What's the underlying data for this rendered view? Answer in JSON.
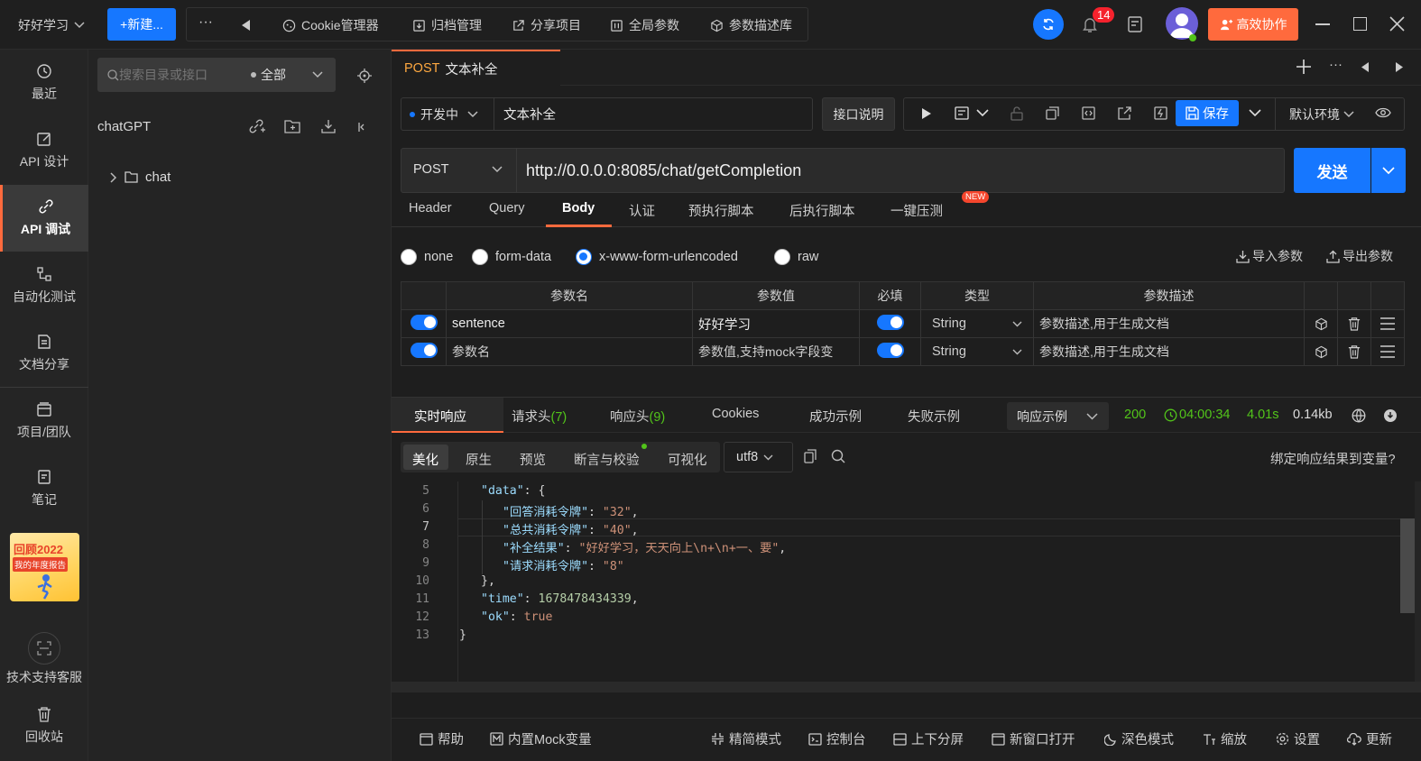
{
  "topbar": {
    "workspace": "好好学习",
    "new_button": "+新建...",
    "more": "···",
    "items": [
      "Cookie管理器",
      "归档管理",
      "分享项目",
      "全局参数",
      "参数描述库"
    ],
    "notification_count": "14",
    "collab_button": "高效协作"
  },
  "nav": {
    "items": [
      "最近",
      "API 设计",
      "API 调试",
      "自动化测试",
      "文档分享",
      "项目/团队",
      "笔记"
    ],
    "promo_line1": "回顾2022",
    "promo_line2": "我的年度报告",
    "support": "技术支持客服",
    "trash": "回收站"
  },
  "tree": {
    "search_placeholder": "搜索目录或接口",
    "filter": "全部",
    "project": "chatGPT",
    "folder": "chat"
  },
  "request_tab": {
    "method": "POST",
    "name": "文本补全"
  },
  "toolbar": {
    "status": "开发中",
    "name": "文本补全",
    "doc_button": "接口说明",
    "save": "保存",
    "env": "默认环境"
  },
  "url_bar": {
    "method": "POST",
    "url": "http://0.0.0.0:8085/chat/getCompletion",
    "send": "发送"
  },
  "req_tabs": [
    "Header",
    "Query",
    "Body",
    "认证",
    "预执行脚本",
    "后执行脚本",
    "一键压测"
  ],
  "new_badge": "NEW",
  "body_types": [
    "none",
    "form-data",
    "x-www-form-urlencoded",
    "raw"
  ],
  "import_params": "导入参数",
  "export_params": "导出参数",
  "params_table": {
    "headers": [
      "参数名",
      "参数值",
      "必填",
      "类型",
      "参数描述"
    ],
    "rows": [
      {
        "name": "sentence",
        "value": "好好学习",
        "type": "String",
        "desc_placeholder": "参数描述,用于生成文档"
      },
      {
        "name_placeholder": "参数名",
        "value_placeholder": "参数值,支持mock字段变",
        "type": "String",
        "desc_placeholder": "参数描述,用于生成文档"
      }
    ]
  },
  "resp_tabs": [
    "实时响应",
    "请求头",
    "(7)",
    "响应头",
    "(9)",
    "Cookies",
    "成功示例",
    "失败示例"
  ],
  "resp_example": "响应示例",
  "resp_status": {
    "code": "200",
    "time": "04:00:34",
    "duration": "4.01s",
    "size": "0.14kb"
  },
  "view_tabs": [
    "美化",
    "原生",
    "预览",
    "断言与校验",
    "可视化"
  ],
  "encoding": "utf8",
  "bind_var": "绑定响应结果到变量?",
  "code": {
    "line_numbers": [
      "5",
      "6",
      "7",
      "8",
      "9",
      "10",
      "11",
      "12",
      "13"
    ],
    "l5k": "\"data\"",
    "l5p": ": {",
    "l6k": "\"回答消耗令牌\"",
    "l6v": "\"32\"",
    "l7k": "\"总共消耗令牌\"",
    "l7v": "\"40\"",
    "l8k": "\"补全结果\"",
    "l8v": "\"好好学习，天天向上\\n+\\n+一、要\"",
    "l9k": "\"请求消耗令牌\"",
    "l9v": "\"8\"",
    "l10": "},",
    "l11k": "\"time\"",
    "l11v": "1678478434339",
    "l12k": "\"ok\"",
    "l12v": "true",
    "l13": "}"
  },
  "bottom": [
    "帮助",
    "内置Mock变量",
    "精简模式",
    "控制台",
    "上下分屏",
    "新窗口打开",
    "深色模式",
    "缩放",
    "设置",
    "更新"
  ]
}
